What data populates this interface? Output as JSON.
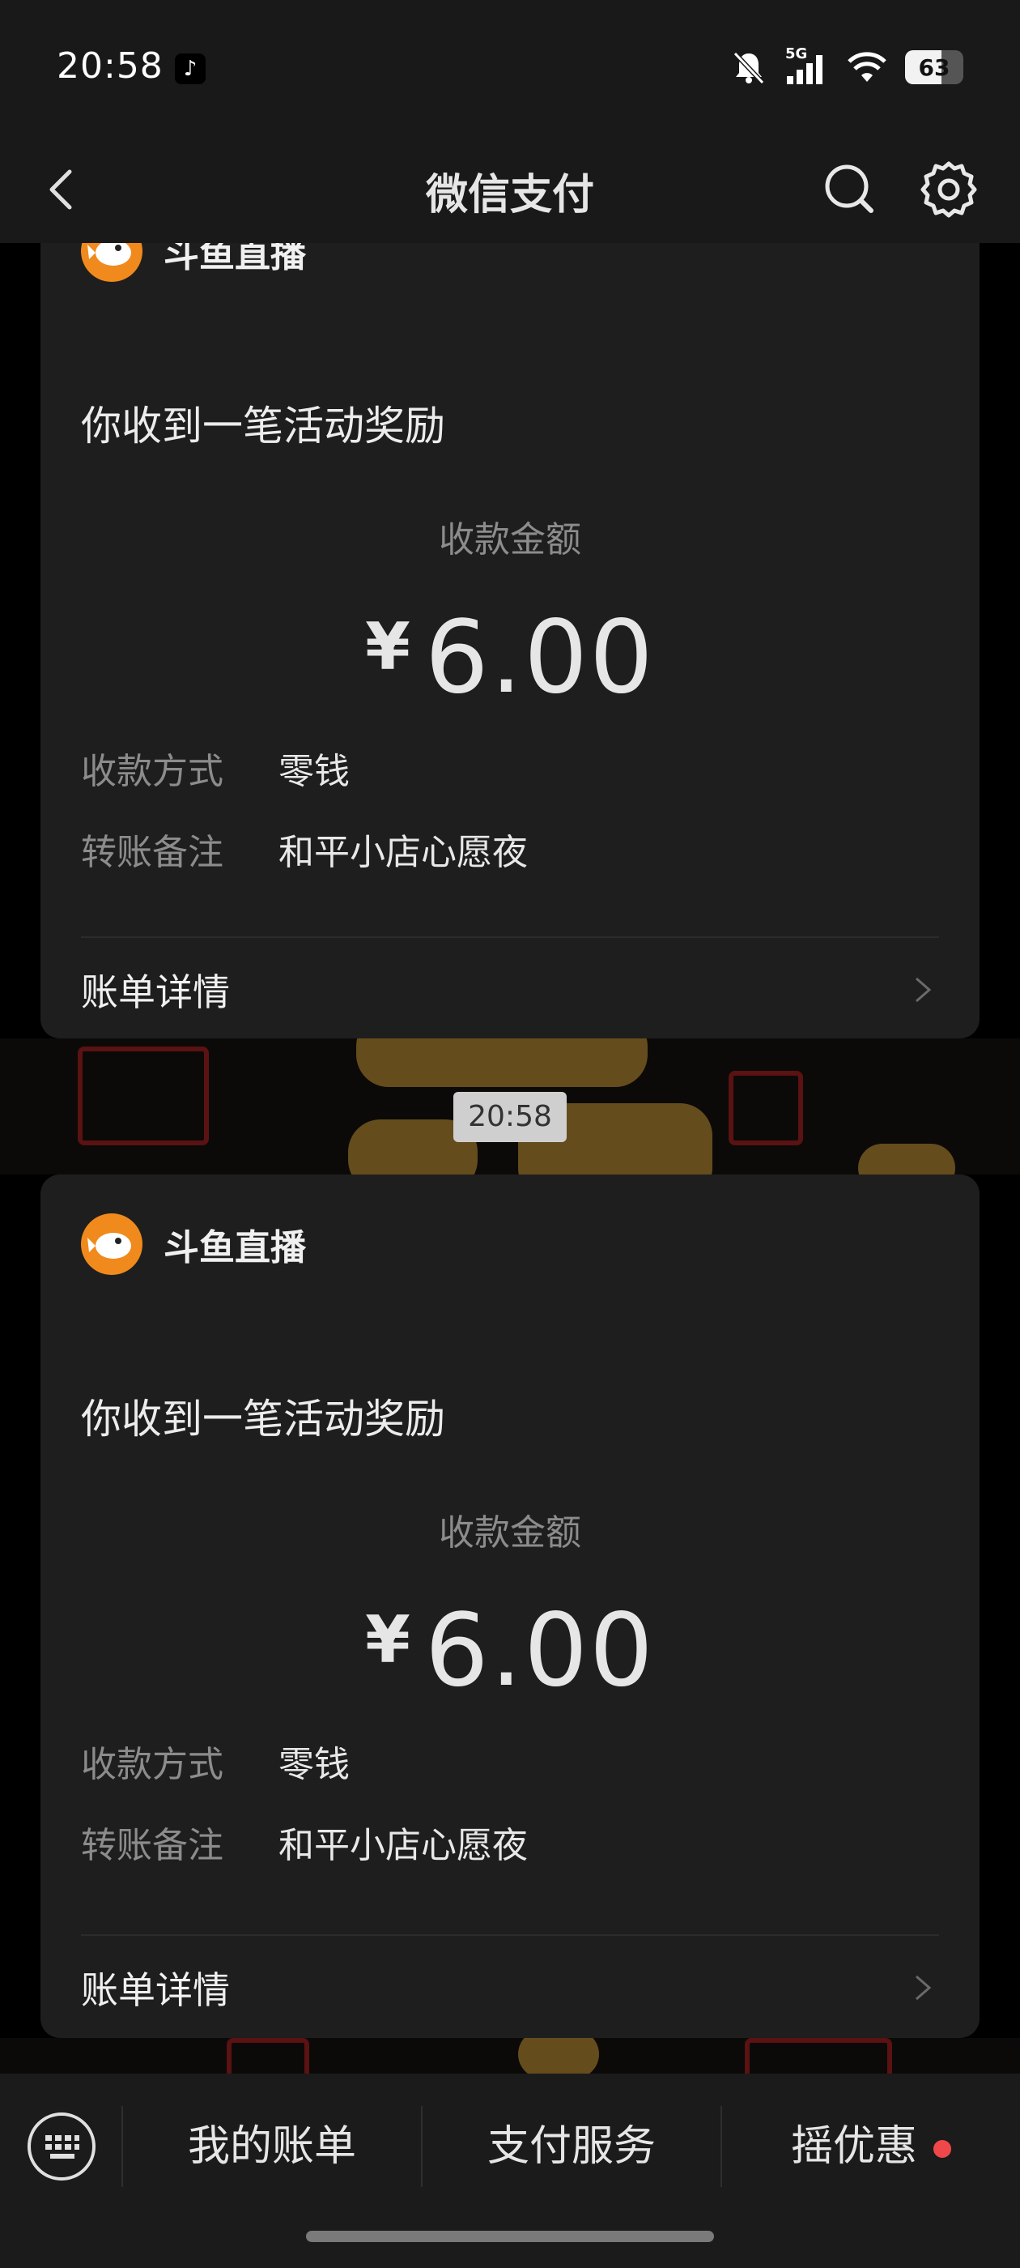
{
  "status_bar": {
    "time": "20:58",
    "network": "5G",
    "battery": "63",
    "battery_level": 0.63
  },
  "header": {
    "title": "微信支付"
  },
  "messages": [
    {
      "app_name": "斗鱼直播",
      "title": "你收到一笔活动奖励",
      "amount_label": "收款金额",
      "currency": "¥",
      "amount": "6.00",
      "rows": [
        {
          "key": "收款方式",
          "value": "零钱"
        },
        {
          "key": "转账备注",
          "value": "和平小店心愿夜"
        }
      ],
      "detail_label": "账单详情"
    },
    {
      "app_name": "斗鱼直播",
      "title": "你收到一笔活动奖励",
      "amount_label": "收款金额",
      "currency": "¥",
      "amount": "6.00",
      "rows": [
        {
          "key": "收款方式",
          "value": "零钱"
        },
        {
          "key": "转账备注",
          "value": "和平小店心愿夜"
        }
      ],
      "detail_label": "账单详情"
    }
  ],
  "timestamp": "20:58",
  "bottom_bar": {
    "items": [
      {
        "label": "我的账单"
      },
      {
        "label": "支付服务"
      },
      {
        "label": "摇优惠",
        "has_dot": true
      }
    ]
  },
  "colors": {
    "accent_dot": "#f0484a",
    "logo": "#f08a1c",
    "card": "#1e1e1e"
  }
}
